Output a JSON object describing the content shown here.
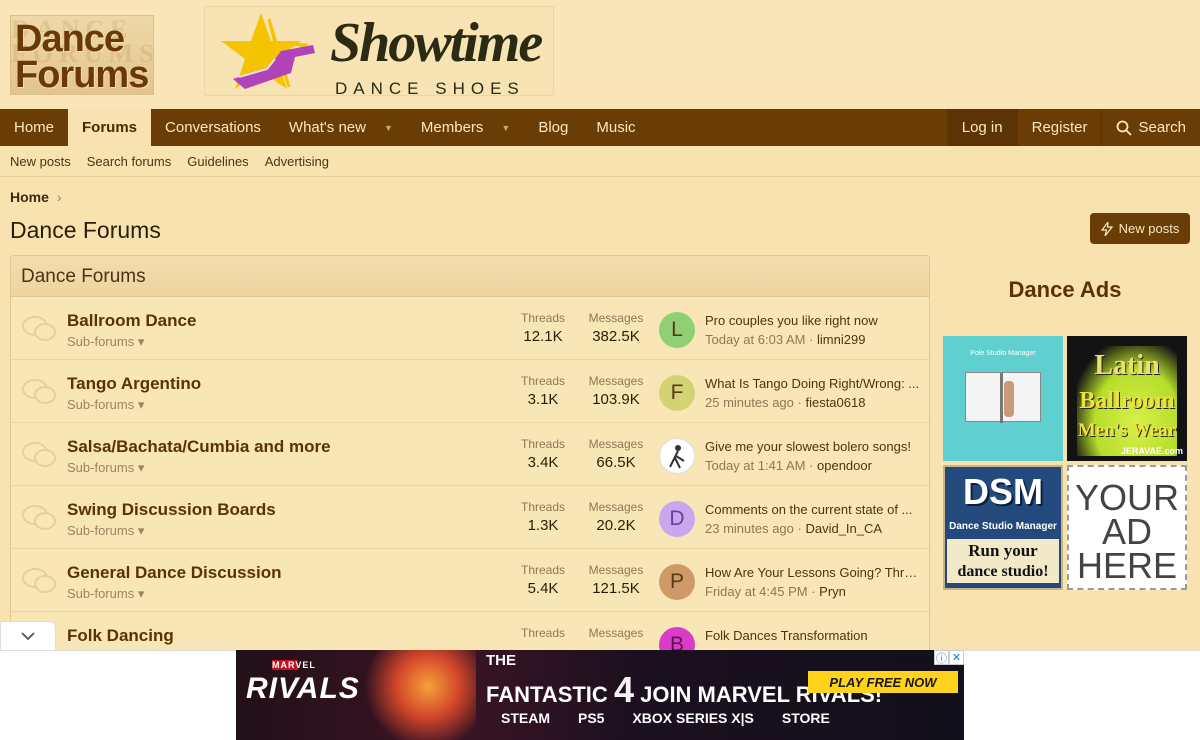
{
  "header": {
    "logo_line1": "Dance",
    "logo_line2": "Forums",
    "banner_title": "Showtime",
    "banner_sub": "DANCE SHOES"
  },
  "nav": {
    "items": [
      "Home",
      "Forums",
      "Conversations",
      "What's new",
      "Members",
      "Blog",
      "Music"
    ],
    "active": "Forums",
    "login": "Log in",
    "register": "Register",
    "search": "Search"
  },
  "subnav": [
    "New posts",
    "Search forums",
    "Guidelines",
    "Advertising"
  ],
  "breadcrumb": "Home",
  "page_title": "Dance Forums",
  "new_posts_button": "New posts",
  "block_title": "Dance Forums",
  "forums": [
    {
      "title": "Ballroom Dance",
      "sub": "Sub-forums",
      "threads_label": "Threads",
      "threads": "12.1K",
      "messages_label": "Messages",
      "messages": "382.5K",
      "avatar": "L",
      "avatar_color": "#8fd074",
      "last_title": "Pro couples you like right now",
      "last_time": "Today at 6:03 AM",
      "last_user": "limni299"
    },
    {
      "title": "Tango Argentino",
      "sub": "Sub-forums",
      "threads_label": "Threads",
      "threads": "3.1K",
      "messages_label": "Messages",
      "messages": "103.9K",
      "avatar": "F",
      "avatar_color": "#d3d374",
      "last_title": "What Is Tango Doing Right/Wrong: ...",
      "last_time": "25 minutes ago",
      "last_user": "fiesta0618"
    },
    {
      "title": "Salsa/Bachata/Cumbia and more",
      "sub": "Sub-forums",
      "threads_label": "Threads",
      "threads": "3.4K",
      "messages_label": "Messages",
      "messages": "66.5K",
      "avatar": "",
      "avatar_color": "#ffffff",
      "last_title": "Give me your slowest bolero songs!",
      "last_time": "Today at 1:41 AM",
      "last_user": "opendoor"
    },
    {
      "title": "Swing Discussion Boards",
      "sub": "Sub-forums",
      "threads_label": "Threads",
      "threads": "1.3K",
      "messages_label": "Messages",
      "messages": "20.2K",
      "avatar": "D",
      "avatar_color": "#c9a6ee",
      "last_title": "Comments on the current state of ...",
      "last_time": "23 minutes ago",
      "last_user": "David_In_CA"
    },
    {
      "title": "General Dance Discussion",
      "sub": "Sub-forums",
      "threads_label": "Threads",
      "threads": "5.4K",
      "messages_label": "Messages",
      "messages": "121.5K",
      "avatar": "P",
      "avatar_color": "#cf9a68",
      "last_title": "How Are Your Lessons Going? Thre...",
      "last_time": "Friday at 4:45 PM",
      "last_user": "Pryn"
    },
    {
      "title": "Folk Dancing",
      "sub": "",
      "threads_label": "Threads",
      "threads": "",
      "messages_label": "Messages",
      "messages": "",
      "avatar": "B",
      "avatar_color": "#d93cc6",
      "last_title": "Folk Dances Transformation",
      "last_time": "",
      "last_user": ""
    }
  ],
  "sidebar": {
    "title": "Dance Ads",
    "ad1_text": "Pole Studio Manager",
    "ad2_line1": "Latin",
    "ad2_line2": "Ballroom",
    "ad2_line3": "Men's Wear",
    "ad2_url": "JERAVAE.com",
    "ad3_line1": "DSM",
    "ad3_line2": "Dance Studio Manager",
    "ad3_line3": "Run your",
    "ad3_line4": "dance studio!",
    "ad4_line1": "YOUR",
    "ad4_line2": "AD",
    "ad4_line3": "HERE"
  },
  "bottom_ad": {
    "brand_small": "MARVEL",
    "brand": "RIVALS",
    "the": "THE",
    "headline": "FANTASTIC",
    "four": "4",
    "join": "JOIN MARVEL RIVALS!",
    "cta": "PLAY FREE NOW",
    "platforms": [
      "STEAM",
      "PS5",
      "XBOX SERIES X|S",
      "STORE"
    ]
  }
}
